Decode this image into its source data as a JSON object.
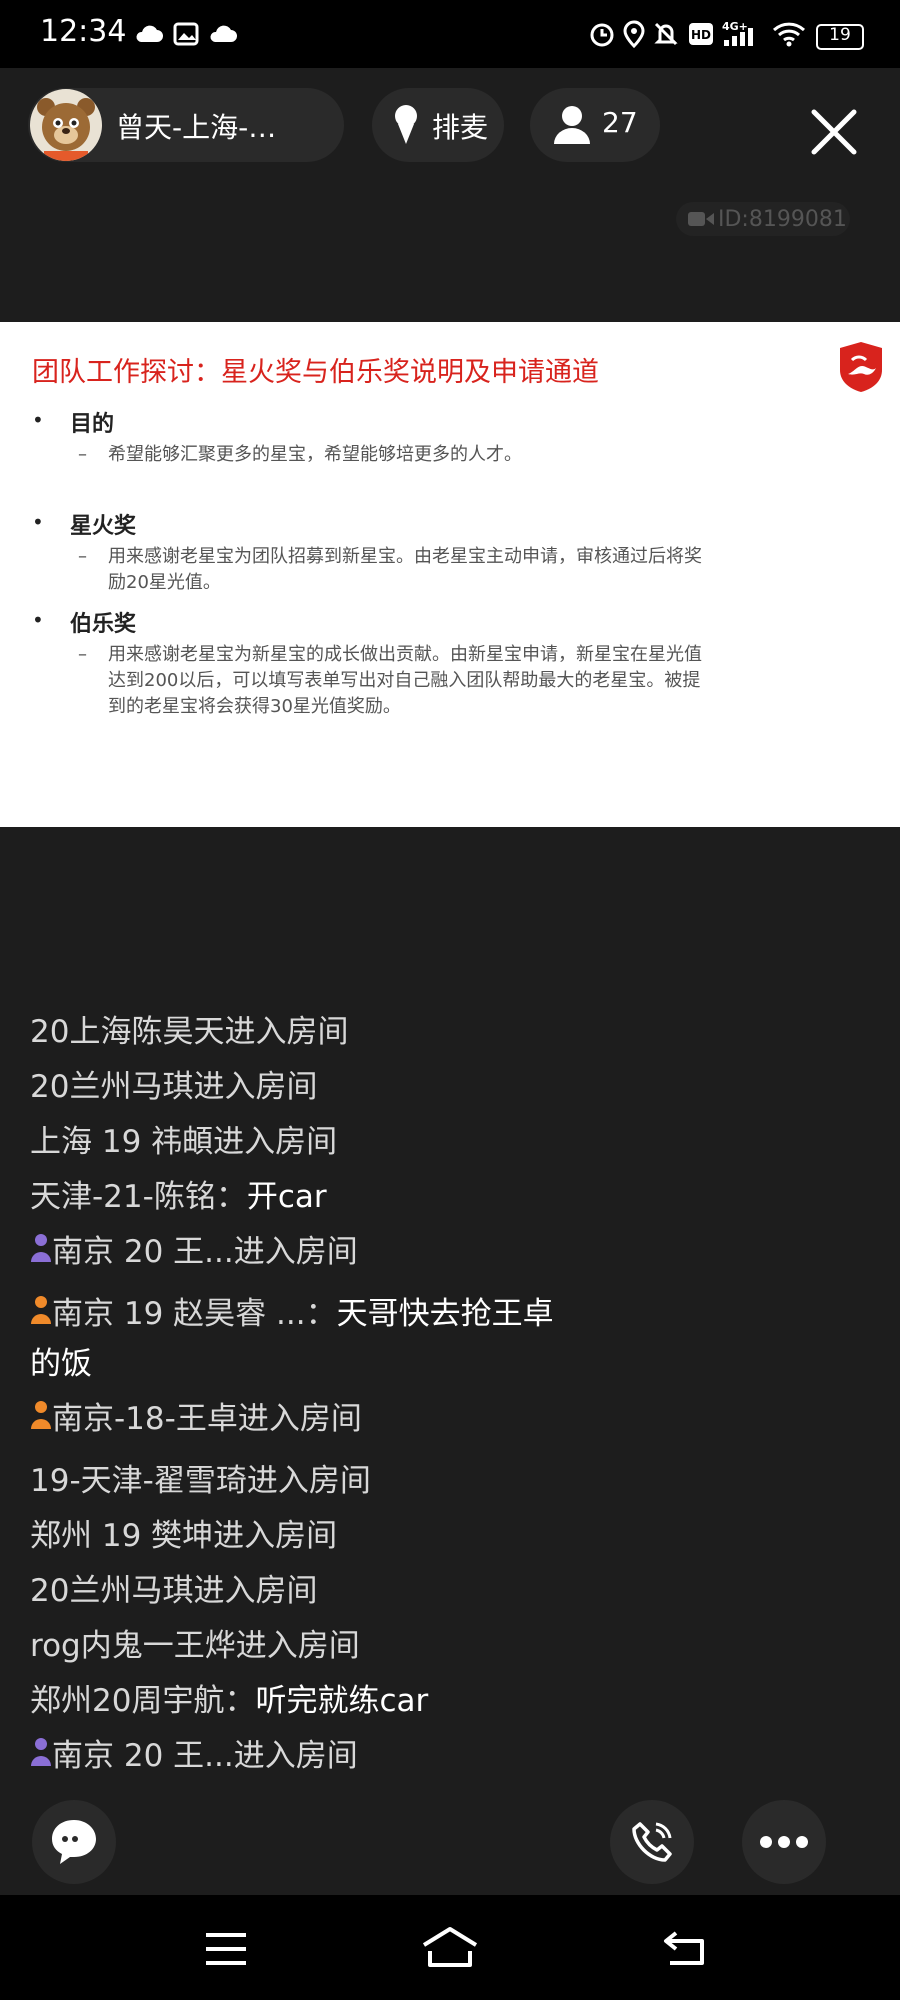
{
  "status_bar": {
    "time": "12:34",
    "network": "4G+",
    "battery": "19",
    "icons": [
      "cloud-icon",
      "image-icon",
      "cloud-icon",
      "alarm-icon",
      "location-icon",
      "mute-icon",
      "hd-icon",
      "signal-icon",
      "wifi-icon",
      "battery-icon"
    ]
  },
  "header": {
    "user_name": "曾天-上海-…",
    "mic_label": "排麦",
    "audience_count": "27",
    "room_id": "ID:8199081"
  },
  "slide": {
    "title": "团队工作探讨：星火奖与伯乐奖说明及申请通道",
    "bullet": "•",
    "dash": "–",
    "sections": [
      {
        "heading": "目的",
        "lines": [
          "希望能够汇聚更多的星宝，希望能够培更多的人才。"
        ]
      },
      {
        "heading": "星火奖",
        "lines": [
          "用来感谢老星宝为团队招募到新星宝。由老星宝主动申请，审核通过后将奖",
          "励20星光值。"
        ]
      },
      {
        "heading": "伯乐奖",
        "lines": [
          "用来感谢老星宝为新星宝的成长做出贡献。由新星宝申请，新星宝在星光值",
          "达到200以后，可以填写表单写出对自己融入团队帮助最大的老星宝。被提",
          "到的老星宝将会获得30星光值奖励。"
        ]
      }
    ]
  },
  "chat": [
    {
      "text": "20上海陈昊天进入房间"
    },
    {
      "text": "20兰州马琪进入房间"
    },
    {
      "text": "上海 19 祎頔进入房间"
    },
    {
      "text": "天津-21-陈铭：",
      "message": "开car"
    },
    {
      "text": "南京  20  王...进入房间",
      "icon": "purple"
    },
    {
      "text": "南京 19 赵昊睿 ...：",
      "message": "天哥快去抢王卓",
      "message_cont": "的饭",
      "icon": "orange"
    },
    {
      "text": "南京-18-王卓进入房间",
      "icon": "orange"
    },
    {
      "text": "19-天津-翟雪琦进入房间"
    },
    {
      "text": "郑州 19 樊坤进入房间"
    },
    {
      "text": "20兰州马琪进入房间"
    },
    {
      "text": "rog内鬼一王烨进入房间"
    },
    {
      "text": "郑州20周宇航：",
      "message": "听完就练car"
    },
    {
      "text": "南京  20  王...进入房间",
      "icon": "purple"
    }
  ],
  "colors": {
    "accent_red": "#d8231d",
    "purple_user": "#8b6fd6",
    "orange_user": "#f08a2a"
  }
}
